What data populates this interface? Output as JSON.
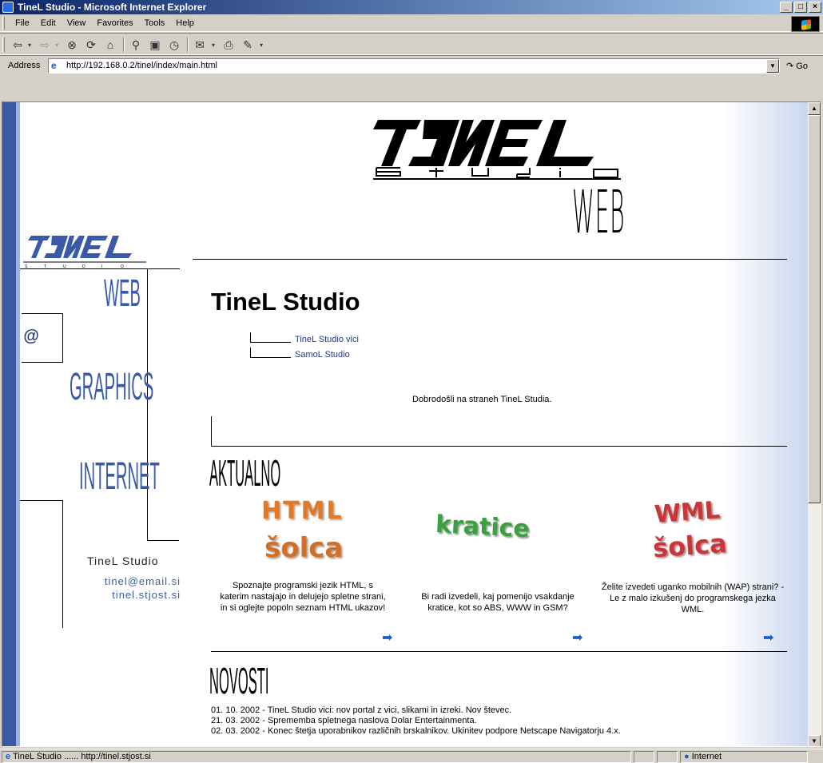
{
  "window": {
    "title": "TineL Studio - Microsoft Internet Explorer",
    "controls": [
      "_",
      "□",
      "×"
    ]
  },
  "menu": [
    "File",
    "Edit",
    "View",
    "Favorites",
    "Tools",
    "Help"
  ],
  "toolbar": {
    "buttons": [
      "back-icon",
      "forward-icon",
      "stop-icon",
      "refresh-icon",
      "home-icon",
      "search-icon",
      "favorites-icon",
      "history-icon",
      "mail-icon",
      "print-icon",
      "edit-icon"
    ]
  },
  "address": {
    "label": "Address",
    "url": "http://192.168.0.2/tinel/index/main.html",
    "go_label": "Go"
  },
  "page": {
    "logo_letters": "TINEL",
    "logo_sub": "S T U D I O",
    "web_label": "WEB",
    "nav": {
      "web": "WEB",
      "graphics": "GRAPHICS",
      "internet": "INTERNET",
      "at_symbol": "@"
    },
    "side": {
      "brand": "TineL Studio",
      "email": "tinel@email.si",
      "site": "tinel.stjost.si"
    },
    "title": "TineL Studio",
    "links": [
      "TineL Studio vici",
      "SamoL Studio"
    ],
    "welcome": "Dobrodošli na straneh TineL Studia.",
    "aktualno": "AKTUALNO",
    "cards": [
      {
        "img_line1": "HTML",
        "img_line2": "šolca",
        "desc": "Spoznajte programski jezik HTML, s katerim nastajajo in delujejo spletne strani, in si oglejte popoln seznam HTML ukazov!"
      },
      {
        "img_line1": "kratice",
        "img_line2": "",
        "desc": "Bi radi izvedeli, kaj pomenijo vsakdanje kratice, kot so ABS, WWW in GSM?"
      },
      {
        "img_line1": "WML",
        "img_line2": "šolca",
        "desc": "Želite izvedeti uganko mobilnih (WAP) strani? - Le z malo izkušenj do programskega jezka WML."
      }
    ],
    "novosti": "NOVOSTI",
    "news": [
      "01. 10. 2002 - TineL Studio vici: nov portal z vici, slikami in izreki. Nov števec.",
      "21. 03. 2002 - Sprememba spletnega naslova Dolar Entertainmenta.",
      "02. 03. 2002 - Konec štetja uporabnikov različnih brskalnikov. Ukinitev podpore Netscape Navigatorju 4.x."
    ]
  },
  "status": {
    "text": "TineL Studio ...... http://tinel.stjost.si",
    "zone": "Internet"
  },
  "colors": {
    "accent": "#3a5aa8",
    "link": "#203880",
    "html_orange": "#e07a28",
    "kratice_green": "#3aa040",
    "wml_red": "#c8363a"
  }
}
